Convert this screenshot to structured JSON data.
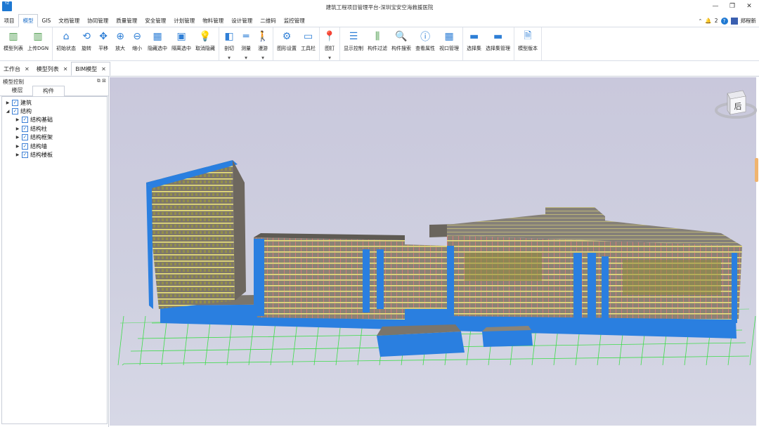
{
  "window": {
    "title": "建筑工程项目管理平台-深圳宝安空海救援医院",
    "logo_text": "YZ"
  },
  "menu": {
    "items": [
      "项目",
      "模型",
      "GIS",
      "文档管理",
      "协同管理",
      "质量管理",
      "安全管理",
      "计划管理",
      "物料管理",
      "设计管理",
      "二维码",
      "监控管理"
    ],
    "active": "模型",
    "notification_count": "2",
    "help_label": "?",
    "user_name": "郑程新"
  },
  "ribbon": {
    "groups": [
      [
        {
          "label": "模型列表",
          "icon": "building-icon"
        },
        {
          "label": "上传DGN",
          "icon": "upload-building-icon"
        }
      ],
      [
        {
          "label": "初始状态",
          "icon": "home-icon"
        },
        {
          "label": "旋转",
          "icon": "rotate-icon"
        },
        {
          "label": "平移",
          "icon": "pan-icon"
        },
        {
          "label": "放大",
          "icon": "zoom-in-icon"
        },
        {
          "label": "缩小",
          "icon": "zoom-out-icon"
        },
        {
          "label": "隐藏选中",
          "icon": "hide-selected-icon"
        },
        {
          "label": "隔离选中",
          "icon": "isolate-selected-icon"
        },
        {
          "label": "取消隐藏",
          "icon": "lightbulb-icon"
        }
      ],
      [
        {
          "label": "剖切",
          "icon": "section-cube-icon",
          "dropdown": true
        },
        {
          "label": "测量",
          "icon": "ruler-icon",
          "dropdown": true
        },
        {
          "label": "漫游",
          "icon": "walk-icon",
          "dropdown": true
        }
      ],
      [
        {
          "label": "图形设置",
          "icon": "graphics-settings-icon"
        },
        {
          "label": "工具栏",
          "icon": "toolbar-icon"
        }
      ],
      [
        {
          "label": "图钉",
          "icon": "pin-icon",
          "dropdown": true
        }
      ],
      [
        {
          "label": "显示控制",
          "icon": "sliders-icon"
        },
        {
          "label": "构件过滤",
          "icon": "filter-icon"
        },
        {
          "label": "构件搜索",
          "icon": "search-icon"
        },
        {
          "label": "查看属性",
          "icon": "info-icon"
        },
        {
          "label": "视口管理",
          "icon": "viewport-icon"
        }
      ],
      [
        {
          "label": "选择集",
          "icon": "selection-set-icon"
        },
        {
          "label": "选择集管理",
          "icon": "selection-manage-icon"
        }
      ],
      [
        {
          "label": "模型版本",
          "icon": "version-icon"
        }
      ]
    ]
  },
  "doc_tabs": [
    {
      "label": "工作台",
      "active": false
    },
    {
      "label": "模型列表",
      "active": false
    },
    {
      "label": "BIM模型",
      "active": true
    }
  ],
  "left_panel": {
    "title": "模型控制",
    "tabs": [
      "楼层",
      "构件"
    ],
    "active_tab": "构件",
    "tree": [
      {
        "label": "建筑",
        "level": 0,
        "expanded": false,
        "checked": true
      },
      {
        "label": "结构",
        "level": 0,
        "expanded": true,
        "checked": true
      },
      {
        "label": "结构基础",
        "level": 1,
        "expanded": false,
        "checked": true
      },
      {
        "label": "结构柱",
        "level": 1,
        "expanded": false,
        "checked": true
      },
      {
        "label": "结构框架",
        "level": 1,
        "expanded": false,
        "checked": true
      },
      {
        "label": "结构墙",
        "level": 1,
        "expanded": false,
        "checked": true
      },
      {
        "label": "结构楼板",
        "level": 1,
        "expanded": false,
        "checked": true
      }
    ]
  },
  "viewport": {
    "nav_cube_face": "后",
    "colors": {
      "slab": "#8a8275",
      "wall": "#2a7fe0",
      "beam": "#f3ea7a",
      "column": "#e07a7a",
      "grid": "#3ddc4a"
    }
  }
}
